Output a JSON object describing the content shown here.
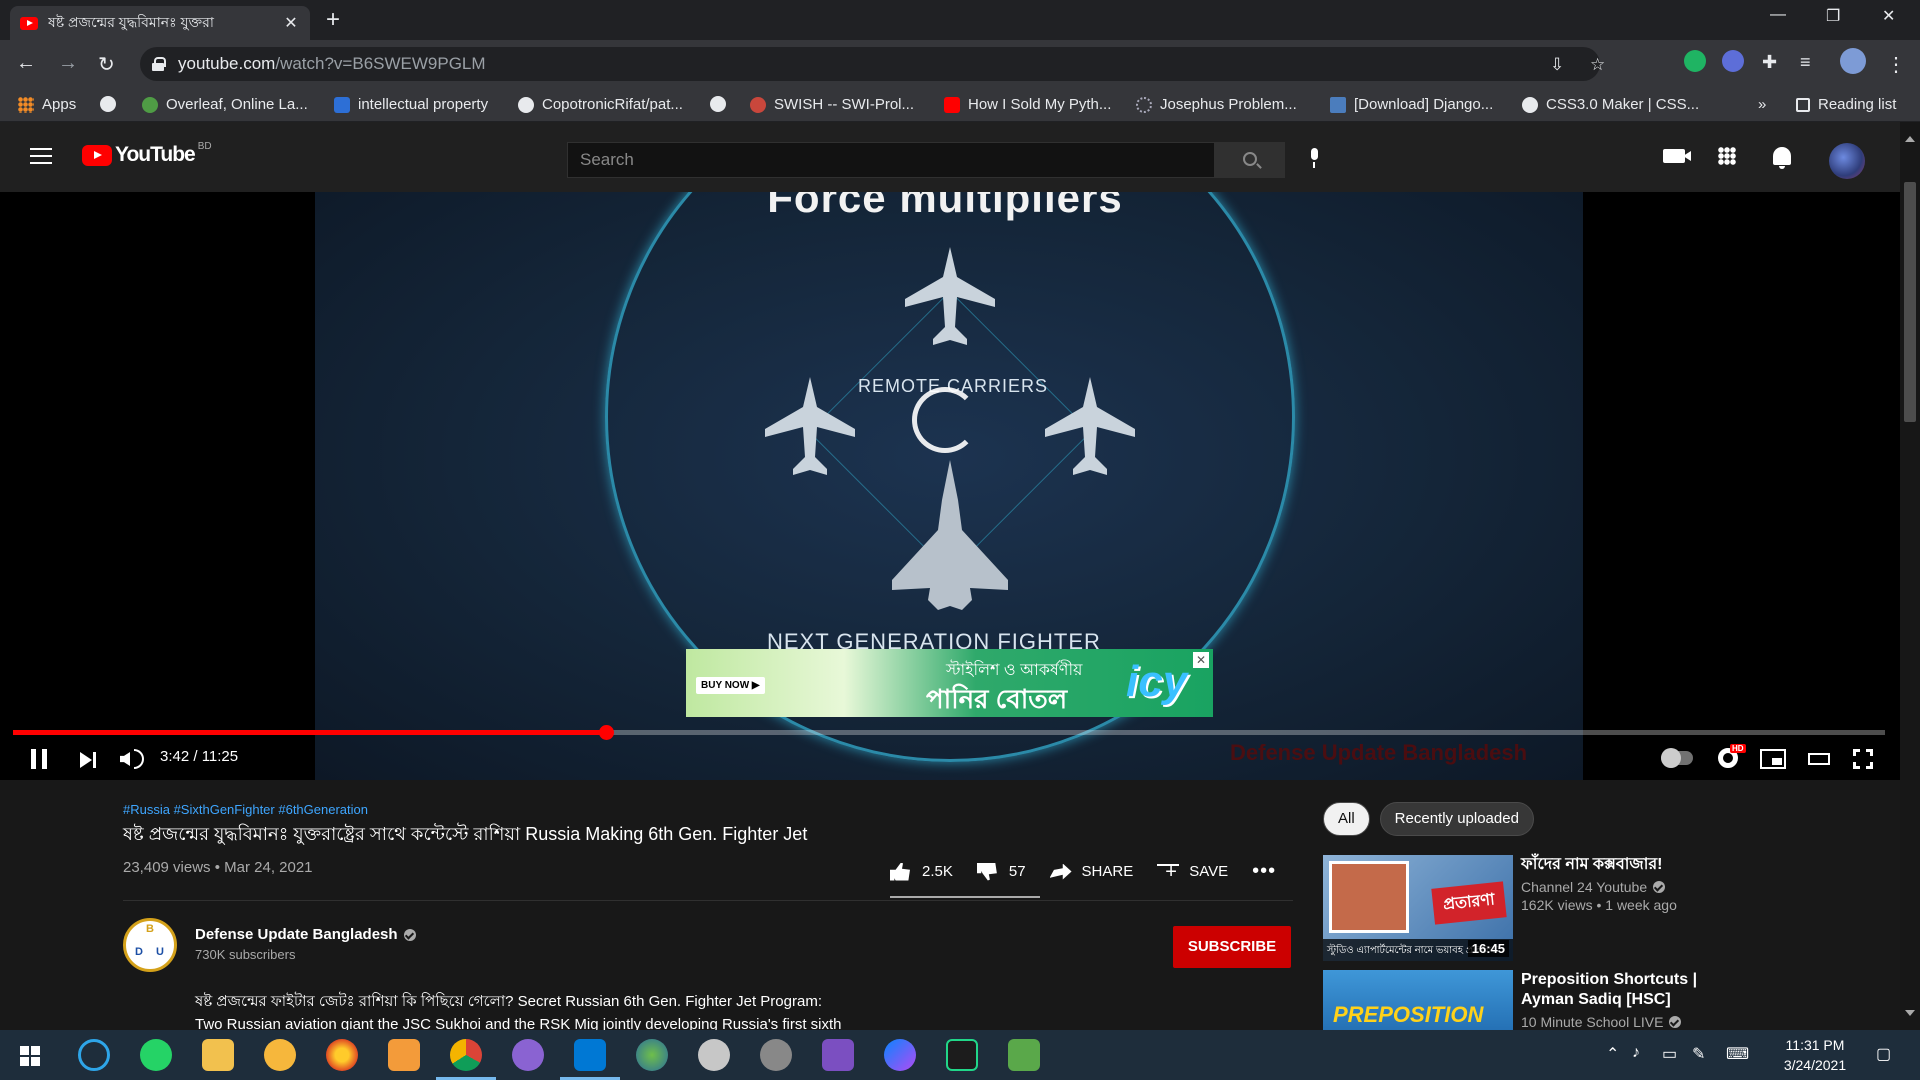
{
  "browser": {
    "tab_title": "ষষ্ট প্রজন্মের যুদ্ধবিমানঃ যুক্তরা",
    "tab_close": "✕",
    "new_tab": "+",
    "url_host": "youtube.com",
    "url_path": "/watch?v=B6SWEW9PGLM",
    "window_controls": {
      "minimize": "—",
      "restore": "❐",
      "close": "✕"
    },
    "bookmarks": [
      "Apps",
      "Overleaf, Online La...",
      "intellectual property",
      "CopotronicRifat/pat...",
      "SWISH -- SWI-Prol...",
      "How I Sold My Pyth...",
      "Josephus Problem...",
      "[Download] Django...",
      "CSS3.0 Maker | CSS..."
    ],
    "bookmarks_overflow": "»",
    "reading_list": "Reading list"
  },
  "youtube": {
    "logo_text": "YouTube",
    "country": "BD",
    "search_placeholder": "Search"
  },
  "player": {
    "frame_title": "Force multipliers",
    "frame_label_top": "REMOTE CARRIERS",
    "frame_label_bottom": "NEXT GENERATION FIGHTER",
    "ad_buy": "BUY NOW ▶",
    "ad_line1": "স্টাইলিশ ও আকর্ষণীয়",
    "ad_line2": "পানির বোতল",
    "ad_brand": "icy",
    "ad_close": "✕",
    "watermark": "Defense Update Bangladesh",
    "time_text": "3:42 / 11:25",
    "progress_played": 0.317,
    "progress_buffered": 0.317,
    "hd_badge": "HD"
  },
  "video": {
    "hashtags": "#Russia #SixthGenFighter #6thGeneration",
    "title": "ষষ্ট প্রজন্মের যুদ্ধবিমানঃ যুক্তরাষ্ট্রের সাথে কন্টেস্টে রাশিয়া Russia Making 6th Gen. Fighter Jet",
    "meta": "23,409 views • Mar 24, 2021",
    "likes": "2.5K",
    "dislikes": "57",
    "share": "SHARE",
    "save": "SAVE",
    "more": "•••",
    "channel_name": "Defense Update Bangladesh",
    "channel_subs": "730K subscribers",
    "subscribe": "SUBSCRIBE",
    "description_line1": "ষষ্ট প্রজন্মের ফাইটার জেটঃ রাশিয়া কি পিছিয়ে গেলো? Secret Russian 6th Gen. Fighter Jet Program:",
    "description_line2": "Two Russian aviation giant the JSC Sukhoi and the RSK Mig jointly developing Russia's first sixth"
  },
  "sidebar": {
    "chips": [
      "All",
      "Recently uploaded"
    ],
    "recommendations": [
      {
        "title": "ফাঁদের নাম কক্সবাজার!",
        "channel": "Channel 24 Youtube",
        "meta": "162K views • 1 week ago",
        "duration": "16:45",
        "thumb_caption": "স্টুডিও এ্যাপার্টমেন্টের নামে ভয়াবহ প্রতারণা"
      },
      {
        "title": "Preposition Shortcuts | Ayman Sadiq [HSC]",
        "channel": "10 Minute School LIVE",
        "meta": "",
        "duration": "",
        "thumb_caption": "PREPOSITION"
      }
    ]
  },
  "taskbar": {
    "time": "11:31 PM",
    "date": "3/24/2021"
  },
  "colors": {
    "yt_red": "#ff0000",
    "subscribe": "#cc0000",
    "link_blue": "#3ea6ff"
  }
}
